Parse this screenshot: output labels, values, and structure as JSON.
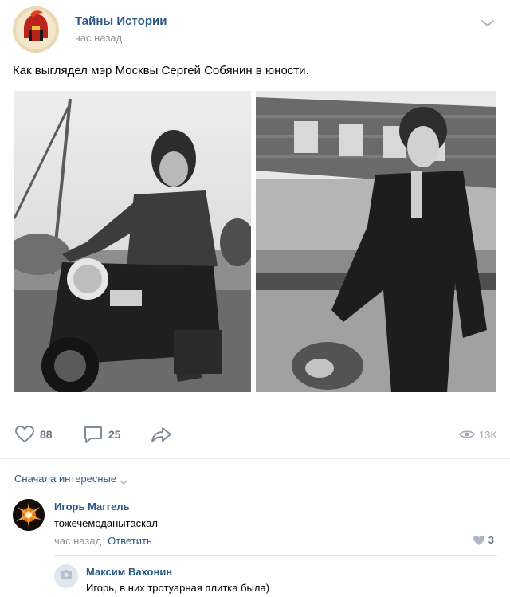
{
  "post": {
    "author": "Тайны Истории",
    "time": "час назад",
    "text": "Как выглядел мэр Москвы Сергей Собянин в юности.",
    "likes": "88",
    "comments": "25",
    "views": "13K"
  },
  "comments": {
    "sort_label": "Сначала интересные",
    "items": [
      {
        "author": "Игорь Маггель",
        "text": "тожечемоданытаскал",
        "time": "час назад",
        "reply_label": "Ответить",
        "likes": "3"
      },
      {
        "author": "Максим Вахонин",
        "text": "Игорь, в них тротуарная плитка была)"
      }
    ]
  },
  "colors": {
    "link": "#2a5885",
    "muted": "#939393",
    "icon": "#6a7683"
  }
}
